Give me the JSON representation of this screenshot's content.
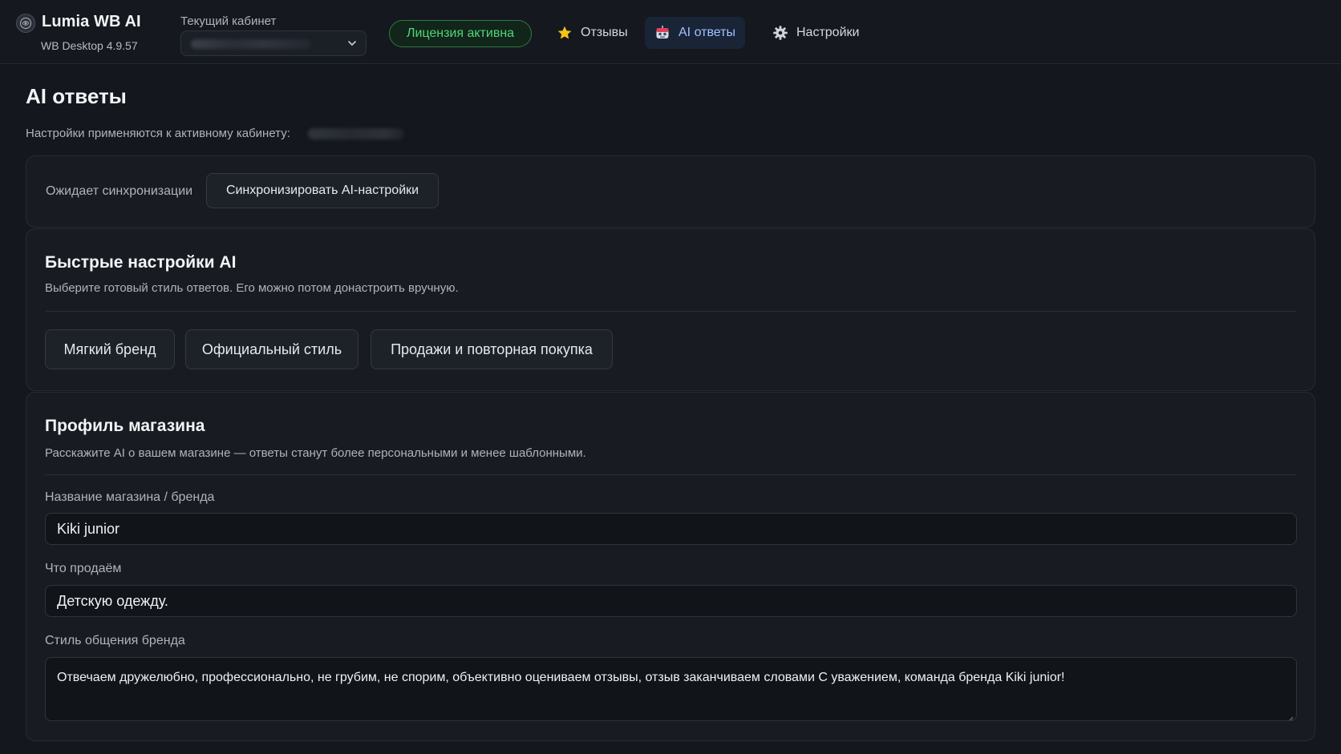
{
  "header": {
    "app_title": "Lumia WB AI",
    "app_version": "WB Desktop 4.9.57",
    "cabinet_label": "Текущий кабинет",
    "cabinet_value": "",
    "license_badge": "Лицензия активна",
    "license_color": "#4fd678",
    "nav": [
      {
        "label": "Отзывы",
        "icon": "star-icon",
        "active": false
      },
      {
        "label": "AI ответы",
        "icon": "robot-icon",
        "active": true
      },
      {
        "label": "Настройки",
        "icon": "gear-icon",
        "active": false
      }
    ]
  },
  "page": {
    "title": "AI ответы",
    "subtitle": "Настройки применяются к активному кабинету:",
    "active_cabinet": ""
  },
  "sync": {
    "status": "Ожидает синхронизации",
    "button_label": "Синхронизировать AI-настройки"
  },
  "quick": {
    "title": "Быстрые настройки AI",
    "description": "Выберите готовый стиль ответов. Его можно потом донастроить вручную.",
    "presets": [
      "Мягкий бренд",
      "Официальный стиль",
      "Продажи и повторная покупка"
    ]
  },
  "profile": {
    "title": "Профиль магазина",
    "description": "Расскажите AI о вашем магазине — ответы станут более персональными и менее шаблонными.",
    "fields": [
      {
        "label": "Название магазина / бренда",
        "value": "Kiki junior"
      },
      {
        "label": "Что продаём",
        "value": "Детскую одежду."
      },
      {
        "label": "Стиль общения бренда",
        "value": "Отвечаем дружелюбно, профессионально, не грубим, не спорим, объективно оцениваем отзывы, отзыв заканчиваем словами С уважением, команда бренда Kiki junior!"
      }
    ]
  },
  "colors": {
    "background": "#14171d",
    "card": "#181b21",
    "accent": "#9ec2ff",
    "star": "#f5c518"
  }
}
